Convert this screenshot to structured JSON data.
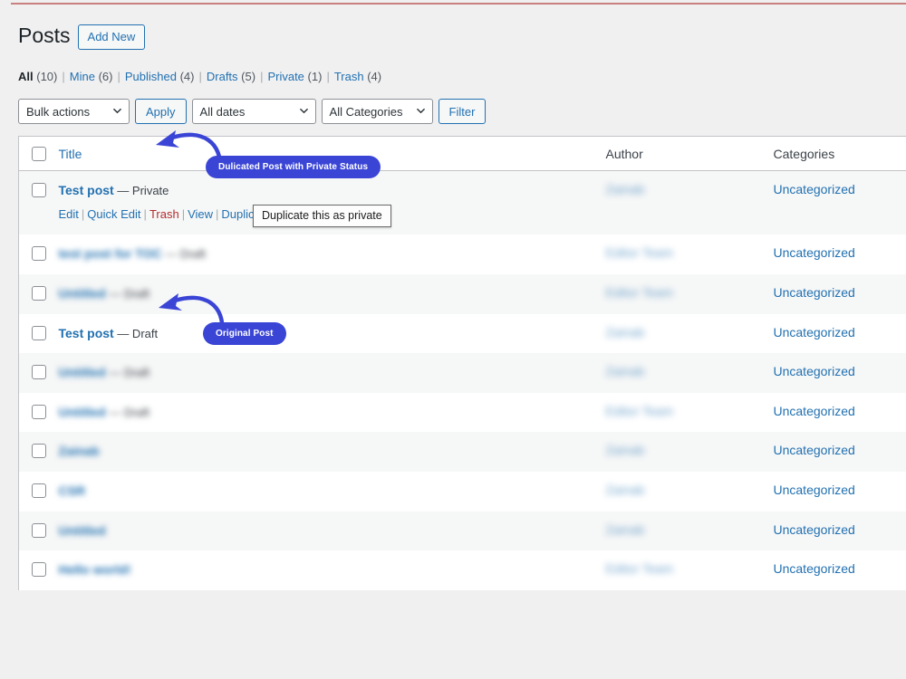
{
  "page": {
    "title": "Posts",
    "add_new_label": "Add New"
  },
  "status_filters": [
    {
      "label": "All",
      "count": "(10)",
      "current": true
    },
    {
      "label": "Mine",
      "count": "(6)",
      "current": false
    },
    {
      "label": "Published",
      "count": "(4)",
      "current": false
    },
    {
      "label": "Drafts",
      "count": "(5)",
      "current": false
    },
    {
      "label": "Private",
      "count": "(1)",
      "current": false
    },
    {
      "label": "Trash",
      "count": "(4)",
      "current": false
    }
  ],
  "toolbar": {
    "bulk_actions_value": "Bulk actions",
    "apply_label": "Apply",
    "dates_value": "All dates",
    "categories_value": "All Categories",
    "filter_label": "Filter"
  },
  "table": {
    "columns": {
      "title": "Title",
      "author": "Author",
      "categories": "Categories"
    },
    "rows": [
      {
        "title": "Test post",
        "status_suffix": " — Private",
        "blurred": false,
        "author": "Zainab",
        "author_blurred": true,
        "category": "Uncategorized",
        "actions": [
          "Edit",
          "Quick Edit",
          "Trash",
          "View",
          "Duplicate This"
        ]
      },
      {
        "title": "test post for TOC",
        "status_suffix": " — Draft",
        "blurred": true,
        "author": "Editor Team",
        "author_blurred": true,
        "category": "Uncategorized",
        "actions": []
      },
      {
        "title": "Untitled",
        "status_suffix": " — Draft",
        "blurred": true,
        "author": "Editor Team",
        "author_blurred": true,
        "category": "Uncategorized",
        "actions": []
      },
      {
        "title": "Test post",
        "status_suffix": " — Draft",
        "blurred": false,
        "author": "Zainab",
        "author_blurred": true,
        "category": "Uncategorized",
        "actions": []
      },
      {
        "title": "Untitled",
        "status_suffix": " — Draft",
        "blurred": true,
        "author": "Zainab",
        "author_blurred": true,
        "category": "Uncategorized",
        "actions": []
      },
      {
        "title": "Untitled",
        "status_suffix": " — Draft",
        "blurred": true,
        "author": "Editor Team",
        "author_blurred": true,
        "category": "Uncategorized",
        "actions": []
      },
      {
        "title": "Zainab",
        "status_suffix": "",
        "blurred": true,
        "author": "Zainab",
        "author_blurred": true,
        "category": "Uncategorized",
        "actions": []
      },
      {
        "title": "CSR",
        "status_suffix": "",
        "blurred": true,
        "author": "Zainab",
        "author_blurred": true,
        "category": "Uncategorized",
        "actions": []
      },
      {
        "title": "Untitled",
        "status_suffix": "",
        "blurred": true,
        "author": "Zainab",
        "author_blurred": true,
        "category": "Uncategorized",
        "actions": []
      },
      {
        "title": "Hello world!",
        "status_suffix": "",
        "blurred": true,
        "author": "Editor Team",
        "author_blurred": true,
        "category": "Uncategorized",
        "actions": []
      }
    ]
  },
  "annotations": {
    "badge_duplicate": "Dulicated Post with Private Status",
    "badge_original": "Original Post",
    "tooltip_duplicate": "Duplicate this as private",
    "accent_color": "#3a45d6"
  }
}
